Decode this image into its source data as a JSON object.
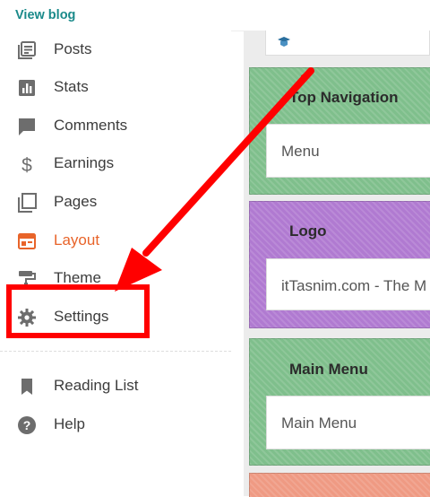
{
  "header": {
    "view_blog": "View blog"
  },
  "sidebar": {
    "items": [
      {
        "label": "Posts",
        "icon": "posts-icon"
      },
      {
        "label": "Stats",
        "icon": "stats-icon"
      },
      {
        "label": "Comments",
        "icon": "comments-icon"
      },
      {
        "label": "Earnings",
        "icon": "dollar-icon"
      },
      {
        "label": "Pages",
        "icon": "pages-icon"
      },
      {
        "label": "Layout",
        "icon": "layout-icon",
        "active": true
      },
      {
        "label": "Theme",
        "icon": "paint-roller-icon"
      },
      {
        "label": "Settings",
        "icon": "gear-icon",
        "highlighted": true
      }
    ],
    "secondary": [
      {
        "label": "Reading List",
        "icon": "bookmark-icon"
      },
      {
        "label": "Help",
        "icon": "help-icon"
      }
    ]
  },
  "layout": {
    "sections": [
      {
        "title": "Top Navigation",
        "widget": "Menu",
        "color": "#7fbf8c"
      },
      {
        "title": "Logo",
        "widget": "itTasnim.com - The M",
        "color": "#b07ad1"
      },
      {
        "title": "Main Menu",
        "widget": "Main Menu",
        "color": "#7fbf8c"
      },
      {
        "title": "",
        "widget": "",
        "color": "#ef9a83"
      }
    ]
  },
  "colors": {
    "accent": "#e8642a",
    "link": "#1a8a8a",
    "annotation": "#ff0000"
  }
}
